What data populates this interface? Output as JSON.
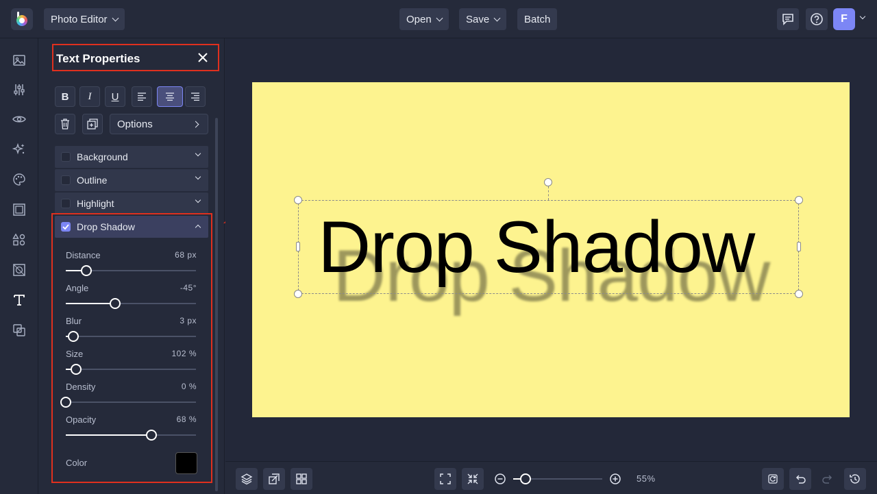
{
  "topbar": {
    "app_switch_label": "Photo Editor",
    "open_label": "Open",
    "save_label": "Save",
    "batch_label": "Batch",
    "avatar_initial": "F"
  },
  "rail": {
    "icons": [
      "image-icon",
      "adjust-sliders-icon",
      "eye-icon",
      "sparkle-icon",
      "palette-icon",
      "frame-icon",
      "shapes-icon",
      "texture-icon",
      "text-icon",
      "overlay-icon"
    ]
  },
  "panel": {
    "title": "Text Properties",
    "format_buttons": {
      "bold": "B",
      "italic": "I",
      "underline": "U"
    },
    "options_label": "Options",
    "sections": {
      "background": "Background",
      "outline": "Outline",
      "highlight": "Highlight",
      "drop_shadow": "Drop Shadow"
    },
    "drop_shadow": {
      "distance": {
        "label": "Distance",
        "value": "68 px",
        "fraction": 0.16
      },
      "angle": {
        "label": "Angle",
        "value": "-45°",
        "fraction": 0.38
      },
      "blur": {
        "label": "Blur",
        "value": "3 px",
        "fraction": 0.06
      },
      "size": {
        "label": "Size",
        "value": "102 %",
        "fraction": 0.08
      },
      "density": {
        "label": "Density",
        "value": "0 %",
        "fraction": 0.0
      },
      "opacity": {
        "label": "Opacity",
        "value": "68 %",
        "fraction": 0.66
      },
      "color_label": "Color",
      "color": "#000000"
    }
  },
  "canvas": {
    "text": "Drop Shadow",
    "background_color": "#fdf38f"
  },
  "bottombar": {
    "zoom_value": "55%",
    "zoom_fraction": 0.14
  }
}
